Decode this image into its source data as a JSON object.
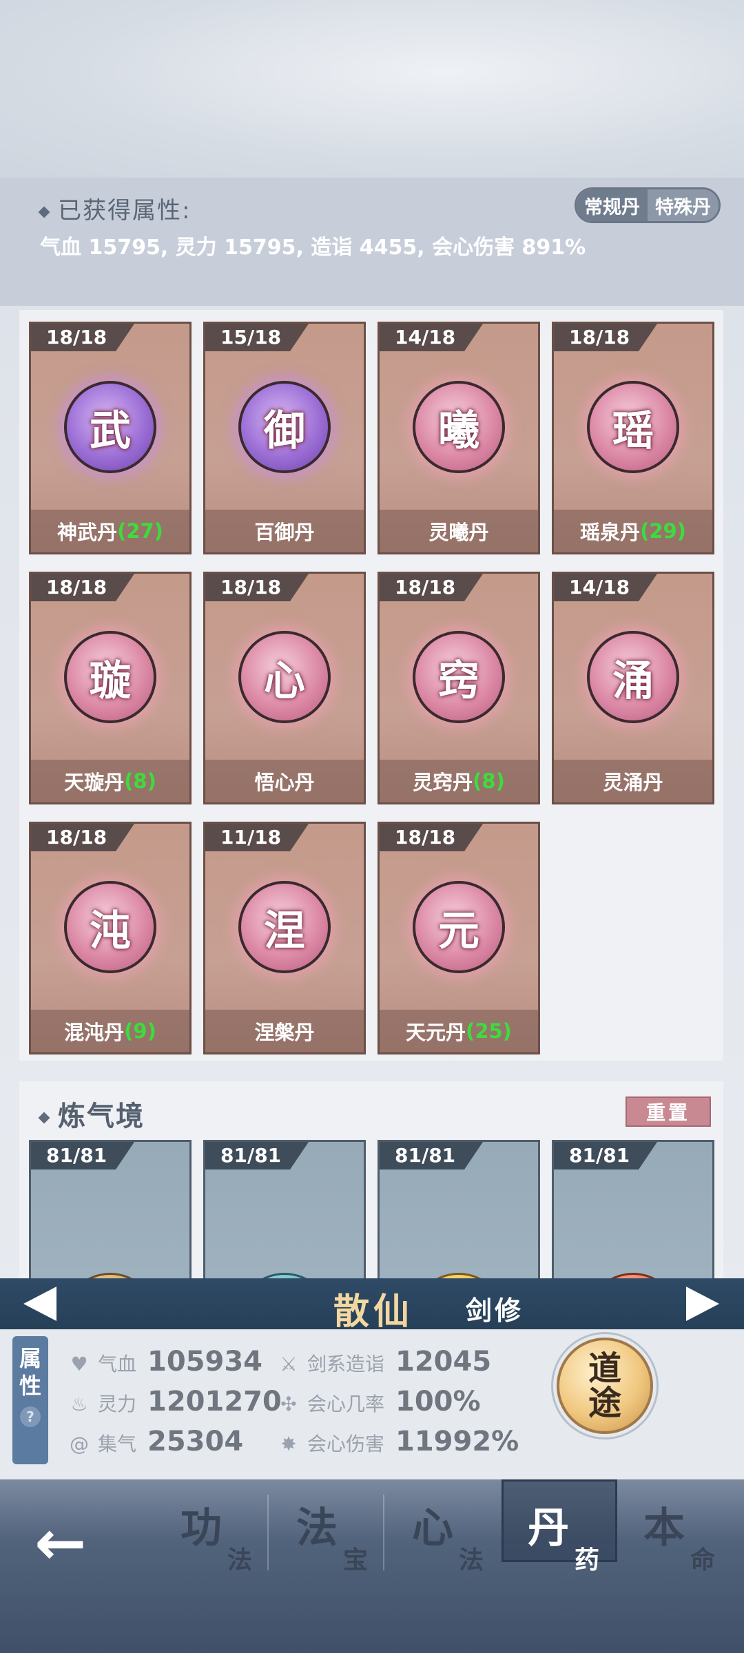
{
  "attributes": {
    "title": "已获得属性:",
    "values": "气血 15795, 灵力 15795, 造诣 4455, 会心伤害 891%",
    "toggle_regular": "常规丹",
    "toggle_special": "特殊丹"
  },
  "dan_cards": [
    {
      "count": "18/18",
      "glyph": "武",
      "name": "神武丹",
      "extra": "(27)",
      "orb": "purple"
    },
    {
      "count": "15/18",
      "glyph": "御",
      "name": "百御丹",
      "extra": "",
      "orb": "purple"
    },
    {
      "count": "14/18",
      "glyph": "曦",
      "name": "灵曦丹",
      "extra": "",
      "orb": "pink"
    },
    {
      "count": "18/18",
      "glyph": "瑶",
      "name": "瑶泉丹",
      "extra": "(29)",
      "orb": "pink"
    },
    {
      "count": "18/18",
      "glyph": "璇",
      "name": "天璇丹",
      "extra": "(8)",
      "orb": "pink"
    },
    {
      "count": "18/18",
      "glyph": "心",
      "name": "悟心丹",
      "extra": "",
      "orb": "pink"
    },
    {
      "count": "18/18",
      "glyph": "窍",
      "name": "灵窍丹",
      "extra": "(8)",
      "orb": "pink"
    },
    {
      "count": "14/18",
      "glyph": "涌",
      "name": "灵涌丹",
      "extra": "",
      "orb": "pink"
    },
    {
      "count": "18/18",
      "glyph": "沌",
      "name": "混沌丹",
      "extra": "(9)",
      "orb": "pink"
    },
    {
      "count": "11/18",
      "glyph": "涅",
      "name": "涅槃丹",
      "extra": "",
      "orb": "pink"
    },
    {
      "count": "18/18",
      "glyph": "元",
      "name": "天元丹",
      "extra": "(25)",
      "orb": "pink"
    }
  ],
  "realm_section": {
    "title": "炼气境",
    "reset_label": "重置",
    "cards": [
      {
        "count": "81/81"
      },
      {
        "count": "81/81"
      },
      {
        "count": "81/81"
      },
      {
        "count": "81/81"
      }
    ]
  },
  "realm_bar": {
    "name": "散仙",
    "class": "剑修"
  },
  "stats": {
    "tab_label_1": "属",
    "tab_label_2": "性",
    "help": "?",
    "items": [
      {
        "label": "气血",
        "value": "105934",
        "icon": "heart-icon"
      },
      {
        "label": "灵力",
        "value": "1201270",
        "icon": "flame-icon"
      },
      {
        "label": "集气",
        "value": "25304",
        "icon": "swirl-icon"
      },
      {
        "label": "剑系造诣",
        "value": "12045",
        "icon": "sword-icon"
      },
      {
        "label": "会心几率",
        "value": "100%",
        "icon": "crit-icon"
      },
      {
        "label": "会心伤害",
        "value": "11992%",
        "icon": "burst-icon"
      }
    ],
    "dao_top": "道",
    "dao_bottom": "途"
  },
  "nav": {
    "back": "←",
    "items": [
      {
        "big": "功",
        "small": "法"
      },
      {
        "big": "法",
        "small": "宝"
      },
      {
        "big": "心",
        "small": "法"
      },
      {
        "big": "丹",
        "small": "药"
      },
      {
        "big": "本",
        "small": "命"
      }
    ]
  }
}
